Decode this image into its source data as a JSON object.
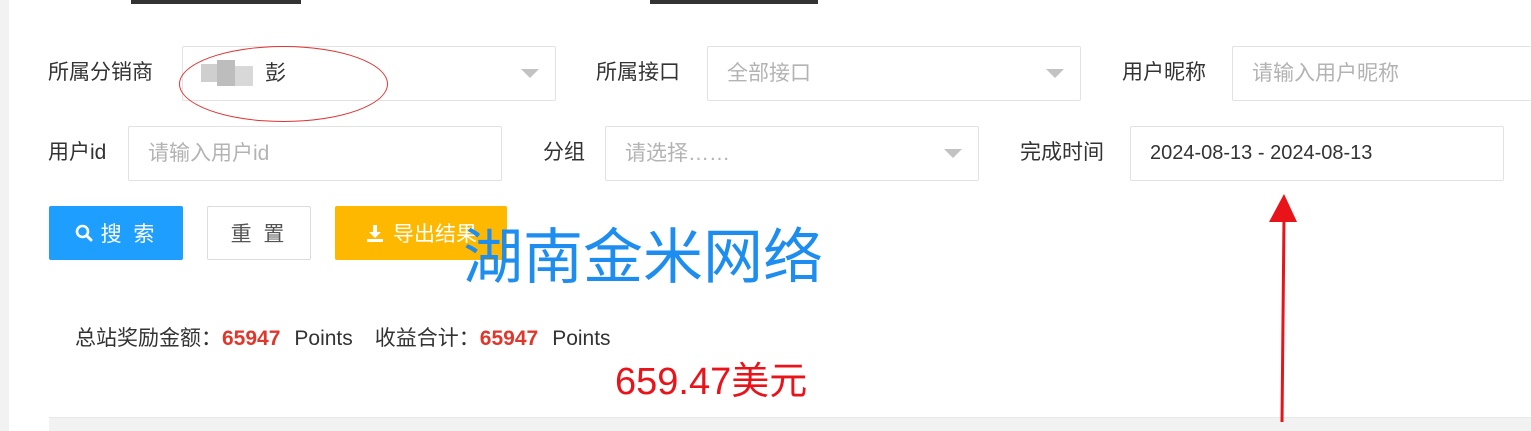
{
  "filters": {
    "distributor": {
      "label": "所属分销商",
      "value_visible": "彭",
      "value_note": "blurred"
    },
    "interface": {
      "label": "所属接口",
      "value": "全部接口"
    },
    "nickname": {
      "label": "用户昵称",
      "placeholder": "请输入用户昵称"
    },
    "user_id": {
      "label": "用户id",
      "placeholder": "请输入用户id"
    },
    "group": {
      "label": "分组",
      "placeholder": "请选择……"
    },
    "finish_time": {
      "label": "完成时间",
      "value": "2024-08-13 - 2024-08-13"
    }
  },
  "buttons": {
    "search": "搜 索",
    "reset": "重 置",
    "export": "导出结果"
  },
  "summary": {
    "total_label": "总站奖励金额：",
    "total_value": "65947",
    "total_unit": "Points",
    "income_label": "收益合计：",
    "income_value": "65947",
    "income_unit": "Points"
  },
  "annotations": {
    "watermark": "湖南金米网络",
    "usd_note": "659.47美元"
  },
  "colors": {
    "primary": "#1e9fff",
    "warning": "#ffb800",
    "amount": "#e0372c",
    "annotation_red": "#e8141a",
    "watermark_blue": "#1e8df0"
  }
}
